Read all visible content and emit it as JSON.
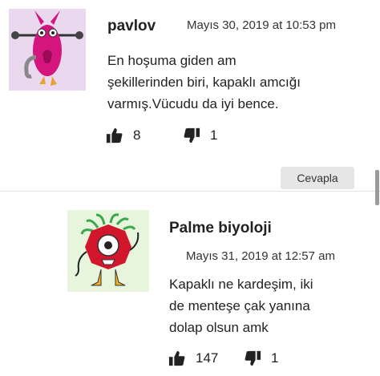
{
  "comments": [
    {
      "author": "pavlov",
      "date": "Mayıs 30, 2019 at 10:53 pm",
      "text_lines": [
        "En hoşuma giden am",
        "şekillerinden biri, kapaklı amcığı",
        "varmış.Vücudu da iyi bence."
      ],
      "likes": "8",
      "dislikes": "1",
      "avatar_bg": "#ead9ee",
      "avatar_icon": "pink-creature-icon"
    },
    {
      "author": "Palme biyoloji",
      "date": "Mayıs 31, 2019 at 12:57 am",
      "text_lines": [
        "Kapaklı ne kardeşim, iki",
        "de menteşe çak yanına",
        "dolap olsun amk"
      ],
      "likes": "147",
      "dislikes": "1",
      "avatar_bg": "#e6f5dc",
      "avatar_icon": "red-creature-icon"
    }
  ],
  "reply_label": "Cevapla"
}
